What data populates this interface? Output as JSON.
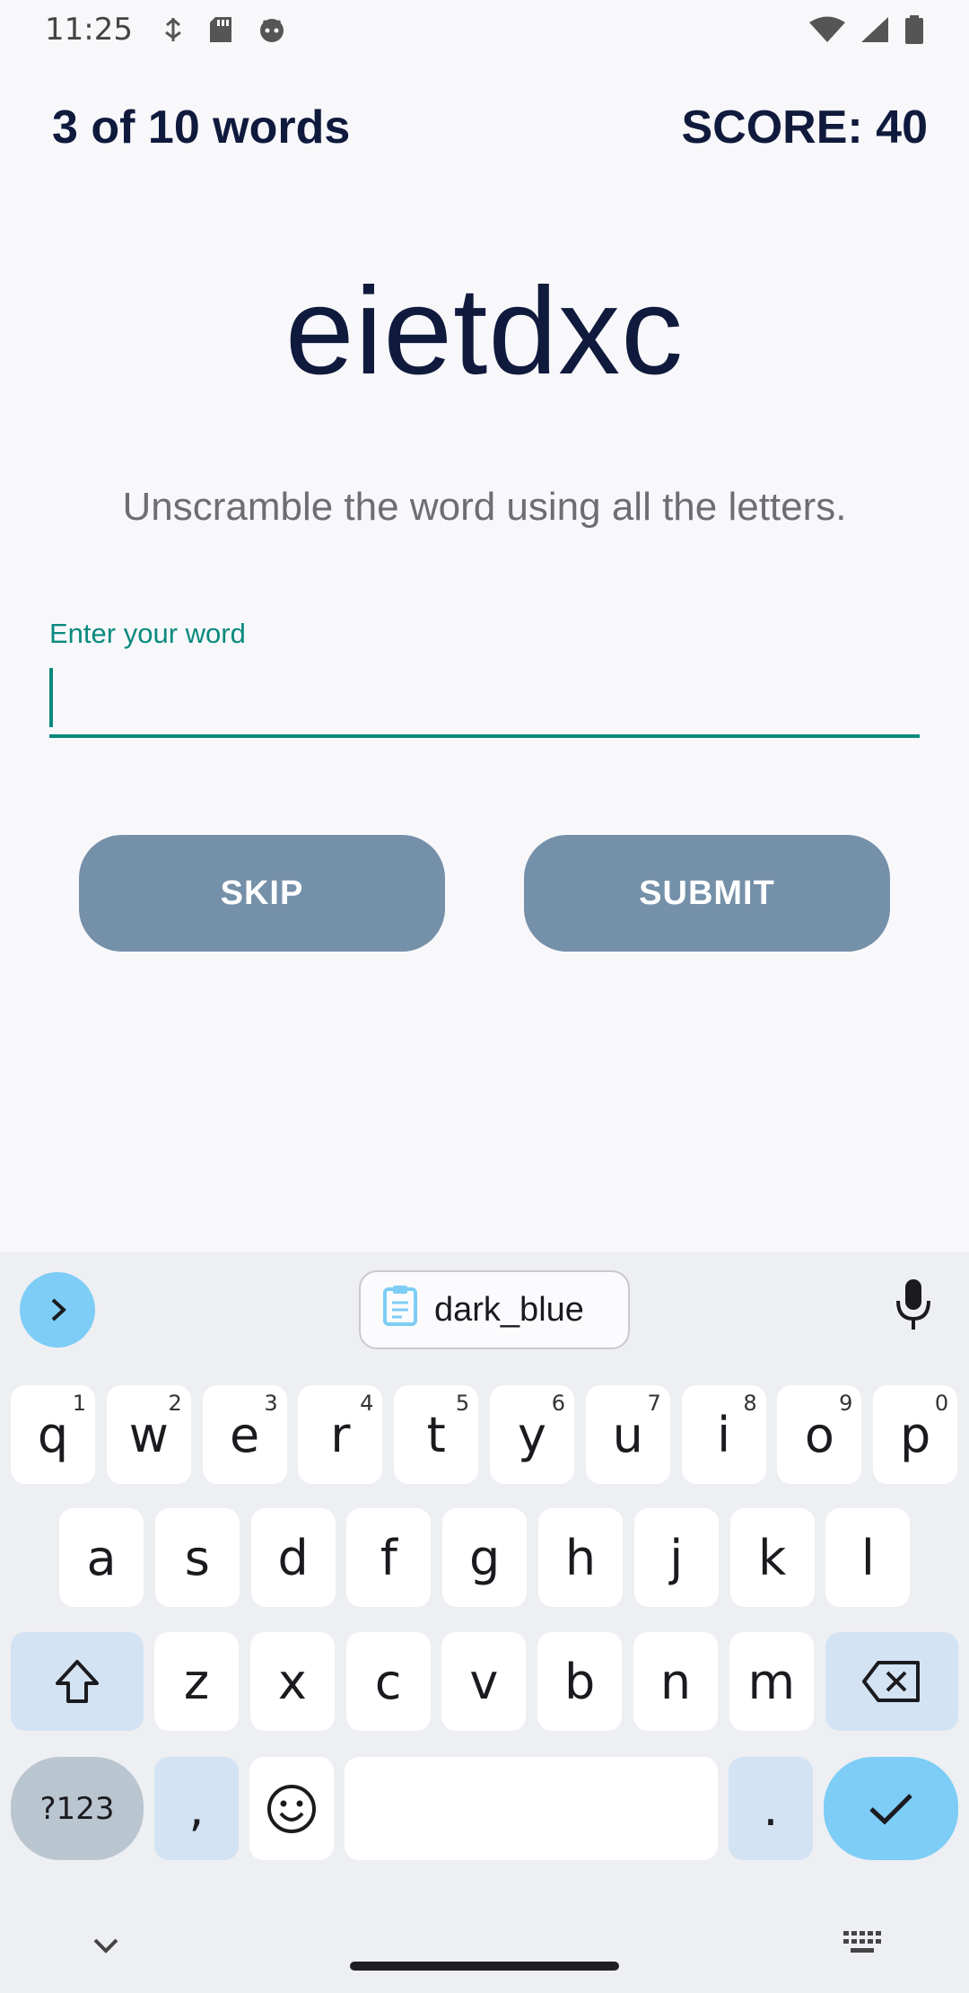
{
  "status_bar": {
    "time": "11:25",
    "left_icons": [
      "usb-debug-icon",
      "sd-card-icon",
      "android-icon"
    ],
    "right_icons": [
      "wifi-icon",
      "signal-icon",
      "battery-icon"
    ]
  },
  "game": {
    "progress": "3 of 10 words",
    "score": "SCORE: 40",
    "scrambled_word": "eietdxc",
    "instructions": "Unscramble the word using all the letters.",
    "input_label": "Enter your word",
    "input_value": "",
    "skip_label": "SKIP",
    "submit_label": "SUBMIT"
  },
  "keyboard": {
    "clipboard_suggestion": "dark_blue",
    "row1": [
      {
        "k": "q",
        "h": "1"
      },
      {
        "k": "w",
        "h": "2"
      },
      {
        "k": "e",
        "h": "3"
      },
      {
        "k": "r",
        "h": "4"
      },
      {
        "k": "t",
        "h": "5"
      },
      {
        "k": "y",
        "h": "6"
      },
      {
        "k": "u",
        "h": "7"
      },
      {
        "k": "i",
        "h": "8"
      },
      {
        "k": "o",
        "h": "9"
      },
      {
        "k": "p",
        "h": "0"
      }
    ],
    "row2": [
      "a",
      "s",
      "d",
      "f",
      "g",
      "h",
      "j",
      "k",
      "l"
    ],
    "row3": [
      "z",
      "x",
      "c",
      "v",
      "b",
      "n",
      "m"
    ],
    "symbols_label": "?123",
    "comma": ",",
    "period": "."
  },
  "colors": {
    "accent_teal": "#0a8a7e",
    "button_bg": "#7590a9",
    "keyboard_accent": "#7dcdf6"
  }
}
